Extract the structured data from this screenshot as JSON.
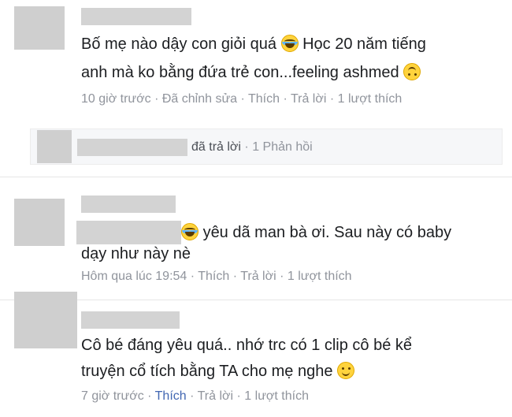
{
  "comments": [
    {
      "line1": "Bố mẹ nào dậy con giỏi quá",
      "line1b": " Học 20 năm tiếng",
      "line2": "anh mà ko bằng đứa trẻ con...feeling ashmed",
      "time": "10 giờ trước",
      "edited": "Đã chỉnh sửa",
      "like": "Thích",
      "reply": "Trả lời",
      "likes": "1 lượt thích",
      "emojis": [
        "laugh",
        "upside-down"
      ]
    },
    {
      "line1": " yêu dã man bà ơi. Sau này có baby",
      "line2": "dạy như này nè",
      "time": "Hôm qua lúc 19:54",
      "like": "Thích",
      "reply": "Trả lời",
      "likes": "1 lượt thích",
      "emojis": [
        "laugh"
      ]
    },
    {
      "line1": "Cô bé đáng yêu quá.. nhớ trc có 1 clip cô bé kể",
      "line2": "truyện cổ tích bằng TA cho mẹ nghe",
      "time": "7 giờ trước",
      "like": "Thích",
      "reply": "Trả lời",
      "likes": "1 lượt thích",
      "emojis": [
        "smile"
      ]
    }
  ],
  "reply_summary": {
    "replied": "đã trả lời",
    "count": "1 Phản hồi"
  },
  "colors": {
    "meta": "#90949c",
    "link_active": "#4267b2",
    "text": "#1c1e21"
  }
}
